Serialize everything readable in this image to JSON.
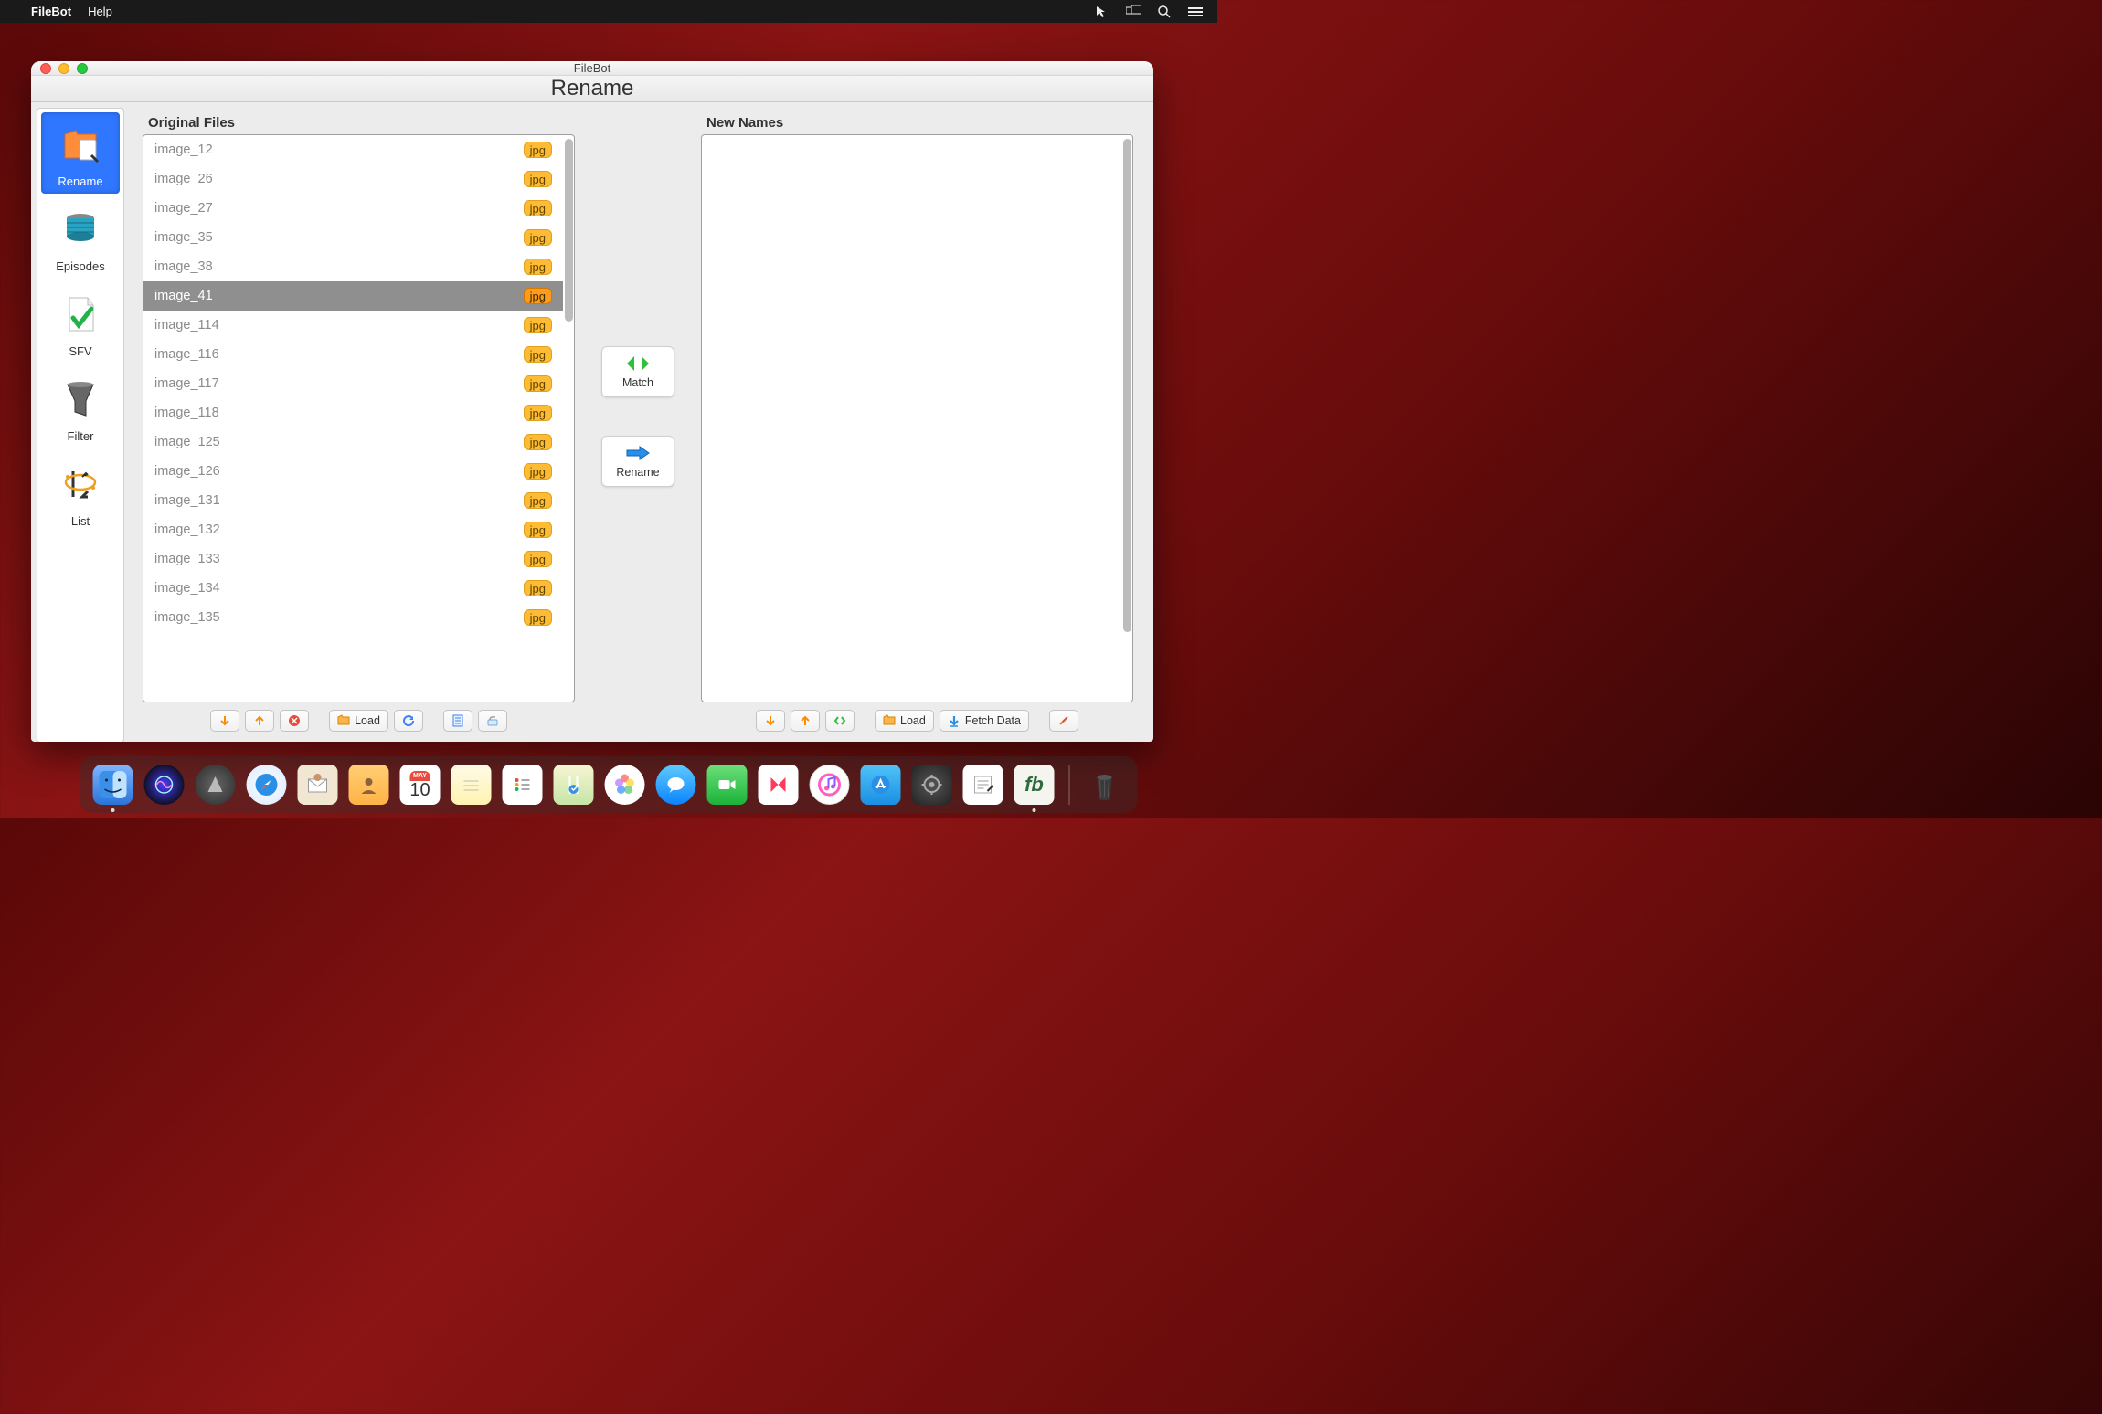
{
  "menubar": {
    "apple": "",
    "app": "FileBot",
    "help": "Help"
  },
  "window": {
    "title": "FileBot",
    "page_title": "Rename"
  },
  "sidebar": {
    "items": [
      {
        "label": "Rename",
        "selected": true
      },
      {
        "label": "Episodes",
        "selected": false
      },
      {
        "label": "SFV",
        "selected": false
      },
      {
        "label": "Filter",
        "selected": false
      },
      {
        "label": "List",
        "selected": false
      }
    ]
  },
  "panels": {
    "original": {
      "title": "Original Files",
      "files": [
        {
          "name": "image_12",
          "ext": "jpg",
          "selected": false
        },
        {
          "name": "image_26",
          "ext": "jpg",
          "selected": false
        },
        {
          "name": "image_27",
          "ext": "jpg",
          "selected": false
        },
        {
          "name": "image_35",
          "ext": "jpg",
          "selected": false
        },
        {
          "name": "image_38",
          "ext": "jpg",
          "selected": false
        },
        {
          "name": "image_41",
          "ext": "jpg",
          "selected": true
        },
        {
          "name": "image_114",
          "ext": "jpg",
          "selected": false
        },
        {
          "name": "image_116",
          "ext": "jpg",
          "selected": false
        },
        {
          "name": "image_117",
          "ext": "jpg",
          "selected": false
        },
        {
          "name": "image_118",
          "ext": "jpg",
          "selected": false
        },
        {
          "name": "image_125",
          "ext": "jpg",
          "selected": false
        },
        {
          "name": "image_126",
          "ext": "jpg",
          "selected": false
        },
        {
          "name": "image_131",
          "ext": "jpg",
          "selected": false
        },
        {
          "name": "image_132",
          "ext": "jpg",
          "selected": false
        },
        {
          "name": "image_133",
          "ext": "jpg",
          "selected": false
        },
        {
          "name": "image_134",
          "ext": "jpg",
          "selected": false
        },
        {
          "name": "image_135",
          "ext": "jpg",
          "selected": false
        }
      ],
      "footer": {
        "load": "Load"
      }
    },
    "newnames": {
      "title": "New Names",
      "footer": {
        "load": "Load",
        "fetch": "Fetch Data"
      }
    }
  },
  "center": {
    "match": "Match",
    "rename": "Rename"
  },
  "dock": {
    "date": {
      "month": "MAY",
      "day": "10"
    },
    "fb": "fb"
  }
}
